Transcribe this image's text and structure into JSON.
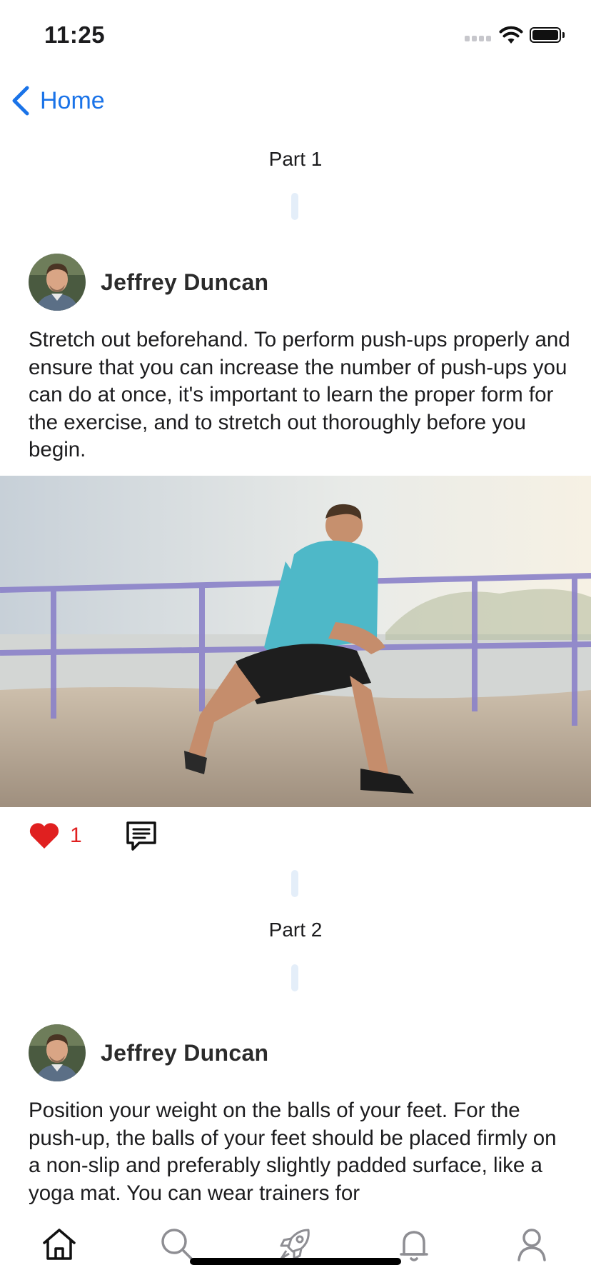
{
  "status": {
    "time": "11:25"
  },
  "nav": {
    "back_label": "Home"
  },
  "posts": [
    {
      "part": "Part 1",
      "author": "Jeffrey Duncan",
      "text": "Stretch out beforehand. To perform push-ups properly and ensure that you can increase the number of push-ups you can do at once, it's important to learn the proper form for the exercise, and to stretch out thoroughly before you begin.",
      "likes": "1"
    },
    {
      "part": "Part 2",
      "author": "Jeffrey Duncan",
      "text": "Position your weight on the balls of your feet. For the push-up, the balls of your feet should be placed firmly on a non-slip and preferably slightly padded surface, like a yoga mat. You can wear trainers for"
    }
  ],
  "tab_bar": {
    "items": [
      {
        "icon": "home-icon"
      },
      {
        "icon": "search-icon"
      },
      {
        "icon": "rocket-icon"
      },
      {
        "icon": "bell-icon"
      },
      {
        "icon": "profile-icon"
      }
    ]
  },
  "colors": {
    "accent": "#1a73e8",
    "like": "#e02020",
    "divider": "#e4eef9"
  }
}
